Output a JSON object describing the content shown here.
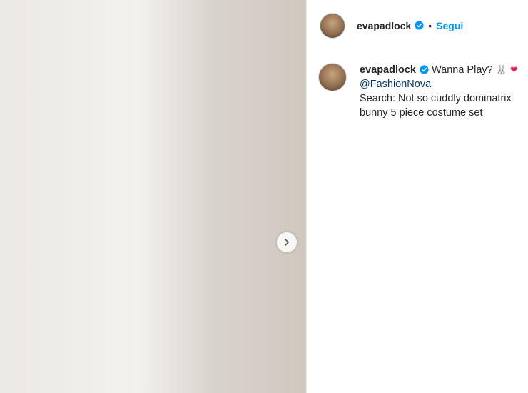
{
  "post": {
    "username": "evapadlock",
    "follow_label": "Segui",
    "separator": "•",
    "verified_icon": "verified-badge-icon",
    "accent_color": "#0095f6",
    "caption": {
      "username": "evapadlock",
      "text": "Wanna Play?",
      "emoji_1": "🐰",
      "emoji_2": "❤",
      "mention": "@FashionNova",
      "body": "Search: Not so cuddly dominatrix bunny 5 piece costume set"
    },
    "media": {
      "carousel_next_icon": "chevron-right-icon"
    }
  }
}
